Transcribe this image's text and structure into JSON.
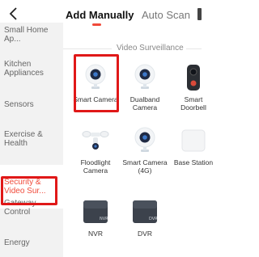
{
  "header": {
    "tabs": [
      {
        "label": "Add Manually",
        "active": true
      },
      {
        "label": "Auto Scan",
        "active": false
      }
    ],
    "accent": "#f04a3a"
  },
  "sidebar": {
    "items": [
      {
        "label": "Small Home Ap...",
        "selected": false
      },
      {
        "label": "Kitchen Appliances",
        "selected": false
      },
      {
        "label": "Sensors",
        "selected": false
      },
      {
        "label": "Exercise & Health",
        "selected": false
      },
      {
        "label": "Security & Video Sur...",
        "selected": true
      },
      {
        "label": "Gateway Control",
        "selected": false
      },
      {
        "label": "Energy",
        "selected": false
      }
    ]
  },
  "main": {
    "section_title": "Video Surveillance",
    "devices": [
      {
        "label": "Smart Camera",
        "icon": "camera-icon"
      },
      {
        "label": "Dualband Camera",
        "icon": "camera-icon"
      },
      {
        "label": "Smart Doorbell",
        "icon": "doorbell-icon"
      },
      {
        "label": "Floodlight Camera",
        "icon": "floodlight-camera-icon"
      },
      {
        "label": "Smart Camera (4G)",
        "icon": "camera-icon"
      },
      {
        "label": "Base Station",
        "icon": "base-station-icon"
      },
      {
        "label": "NVR",
        "icon": "nvr-icon",
        "badge": "NVR"
      },
      {
        "label": "DVR",
        "icon": "dvr-icon",
        "badge": "DVR"
      }
    ]
  }
}
